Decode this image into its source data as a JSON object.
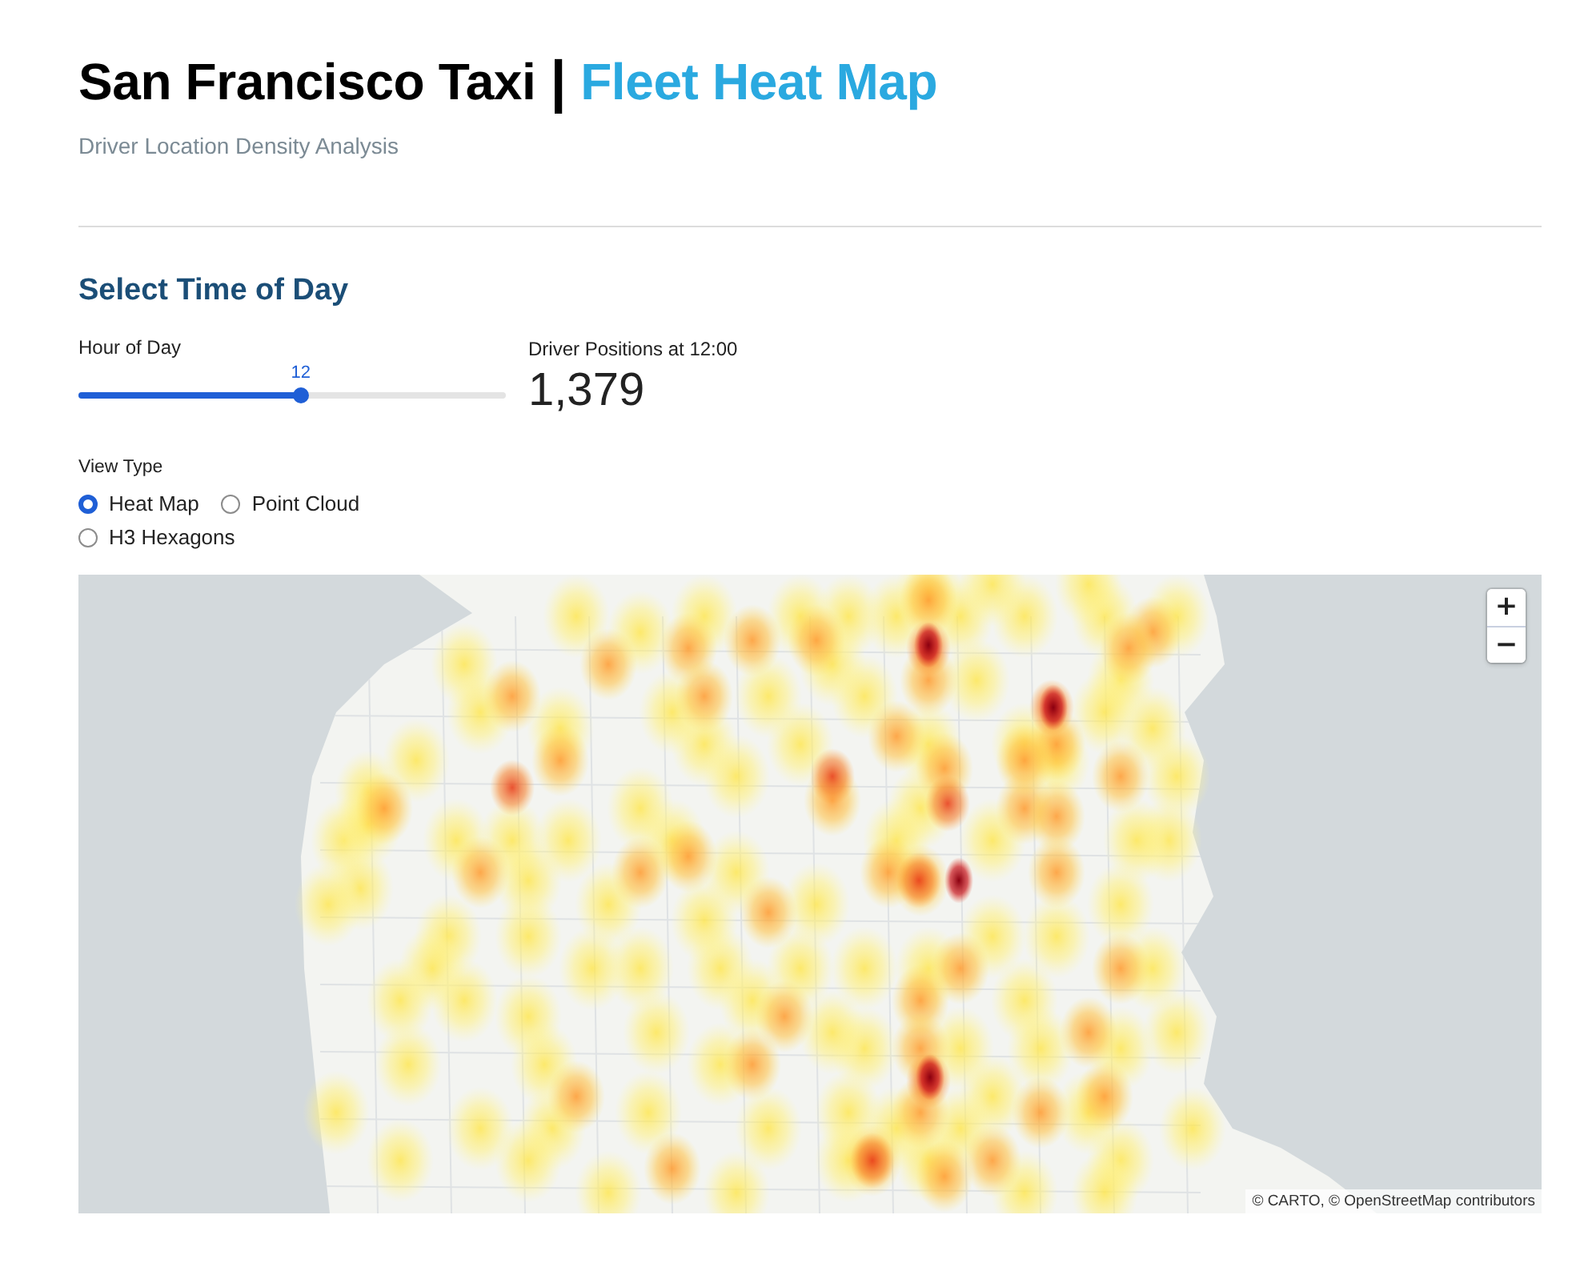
{
  "header": {
    "title": "San Francisco Taxi",
    "separator": "|",
    "title_accent": "Fleet Heat Map",
    "subtitle": "Driver Location Density Analysis"
  },
  "controls": {
    "heading": "Select Time of Day",
    "slider": {
      "label": "Hour of Day",
      "value": "12",
      "level": 0.52
    },
    "metric": {
      "label": "Driver Positions at 12:00",
      "value": "1,379"
    },
    "view_type": {
      "label": "View Type",
      "options": [
        {
          "label": "Heat Map",
          "selected": true
        },
        {
          "label": "Point Cloud",
          "selected": false
        },
        {
          "label": "H3 Hexagons",
          "selected": false
        }
      ]
    }
  },
  "map": {
    "zoom_in": "+",
    "zoom_out": "−",
    "attribution": "© CARTO, © OpenStreetMap contributors"
  }
}
